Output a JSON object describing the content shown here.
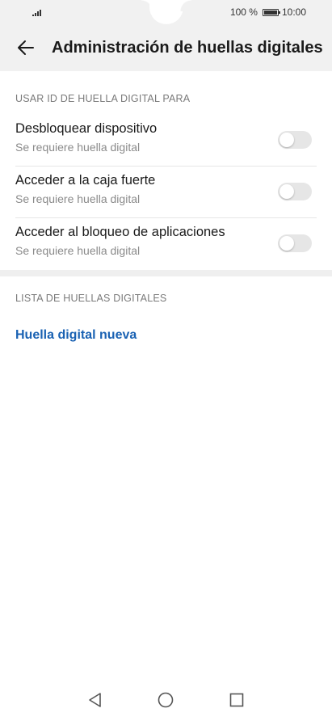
{
  "status_bar": {
    "battery_text": "100 %",
    "time": "10:00"
  },
  "app_bar": {
    "title": "Administración de huellas digitales"
  },
  "sections": {
    "use_id": {
      "header": "USAR ID DE HUELLA DIGITAL PARA",
      "items": [
        {
          "title": "Desbloquear dispositivo",
          "subtitle": "Se requiere huella digital",
          "enabled": false
        },
        {
          "title": "Acceder a la caja fuerte",
          "subtitle": "Se requiere huella digital",
          "enabled": false
        },
        {
          "title": "Acceder al bloqueo de aplicaciones",
          "subtitle": "Se requiere huella digital",
          "enabled": false
        }
      ]
    },
    "list": {
      "header": "LISTA DE HUELLAS DIGITALES",
      "new_link": "Huella digital nueva"
    }
  },
  "colors": {
    "link": "#1a62b3",
    "toggle_off": "#e6e6e6",
    "bar_background": "#f1f1f1"
  },
  "icons": {
    "back": "arrow-left-icon",
    "nav_back": "triangle-back-icon",
    "nav_home": "circle-home-icon",
    "nav_recent": "square-recent-icon"
  }
}
